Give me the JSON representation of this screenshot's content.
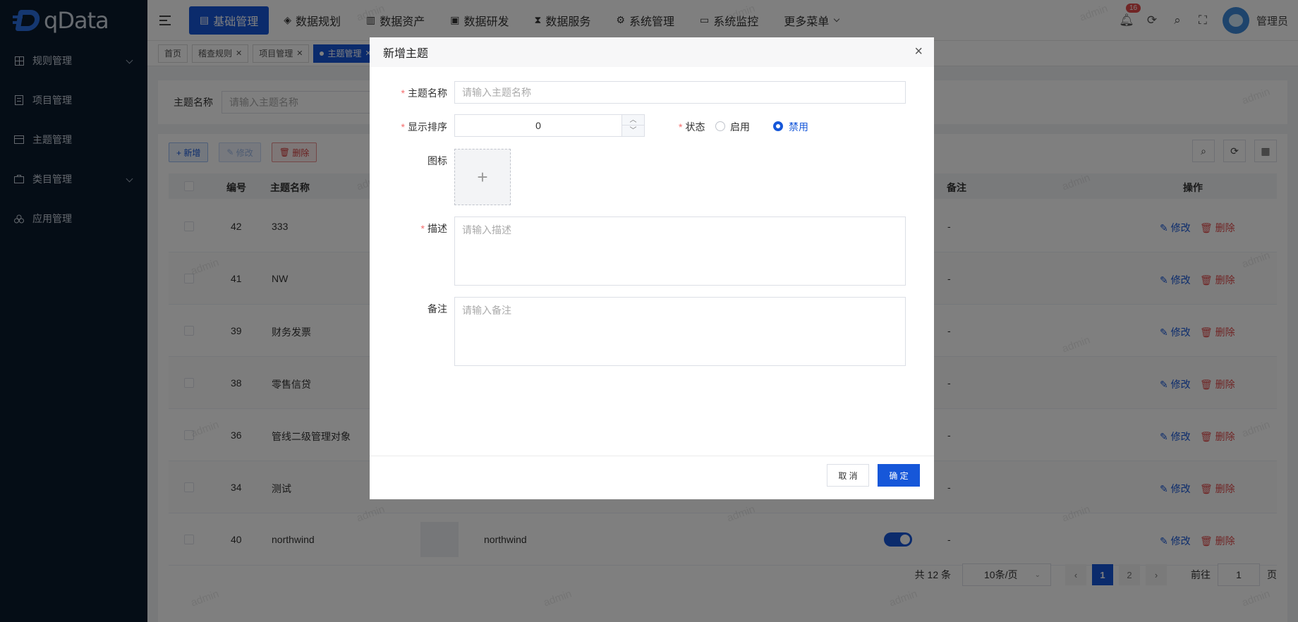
{
  "app": {
    "logo_text": "qData"
  },
  "sidebar": {
    "items": [
      {
        "label": "规则管理",
        "icon": "grid-icon",
        "expandable": true
      },
      {
        "label": "项目管理",
        "icon": "document-icon",
        "expandable": false
      },
      {
        "label": "主题管理",
        "icon": "folder-icon",
        "expandable": false
      },
      {
        "label": "类目管理",
        "icon": "briefcase-icon",
        "expandable": true
      },
      {
        "label": "应用管理",
        "icon": "apps-icon",
        "expandable": false
      }
    ]
  },
  "header": {
    "nav": [
      {
        "label": "基础管理",
        "active": true
      },
      {
        "label": "数据规划"
      },
      {
        "label": "数据资产"
      },
      {
        "label": "数据研发"
      },
      {
        "label": "数据服务"
      },
      {
        "label": "系统管理"
      },
      {
        "label": "系统监控"
      },
      {
        "label": "更多菜单"
      }
    ],
    "notification_count": "16",
    "username": "管理员"
  },
  "tags": [
    {
      "label": "首页"
    },
    {
      "label": "稽查规则"
    },
    {
      "label": "项目管理"
    },
    {
      "label": "主题管理",
      "active": true
    }
  ],
  "search": {
    "label": "主题名称",
    "placeholder": "请输入主题名称"
  },
  "toolbar": {
    "add": "+ 新增",
    "edit": "修改",
    "delete": "删除"
  },
  "table": {
    "headers": {
      "id": "编号",
      "name": "主题名称",
      "remark": "备注",
      "ops": "操作"
    },
    "rows": [
      {
        "id": "42",
        "name": "333",
        "remark": "-"
      },
      {
        "id": "41",
        "name": "NW",
        "remark": "-"
      },
      {
        "id": "39",
        "name": "财务发票",
        "remark": "-"
      },
      {
        "id": "38",
        "name": "零售信贷",
        "remark": "-"
      },
      {
        "id": "36",
        "name": "管线二级管理对象",
        "remark": "-"
      },
      {
        "id": "34",
        "name": "测试",
        "remark": "-"
      },
      {
        "id": "40",
        "name": "northwind",
        "desc": "northwind",
        "remark": "-"
      }
    ],
    "op_edit": "修改",
    "op_delete": "删除"
  },
  "pager": {
    "total": "共 12 条",
    "size": "10条/页",
    "pages": [
      "1",
      "2"
    ],
    "current": "1",
    "goto_label": "前往",
    "goto_value": "1",
    "goto_unit": "页"
  },
  "watermark": "admin",
  "dialog": {
    "title": "新增主题",
    "fields": {
      "name_label": "主题名称",
      "name_placeholder": "请输入主题名称",
      "order_label": "显示排序",
      "order_value": "0",
      "status_label": "状态",
      "status_enabled": "启用",
      "status_disabled": "禁用",
      "status_selected": "禁用",
      "icon_label": "图标",
      "desc_label": "描述",
      "desc_placeholder": "请输入描述",
      "remark_label": "备注",
      "remark_placeholder": "请输入备注"
    },
    "cancel": "取 消",
    "ok": "确 定"
  },
  "colors": {
    "primary": "#1657d9",
    "sidebar_bg": "#0b1a2c",
    "danger": "#e04848"
  }
}
